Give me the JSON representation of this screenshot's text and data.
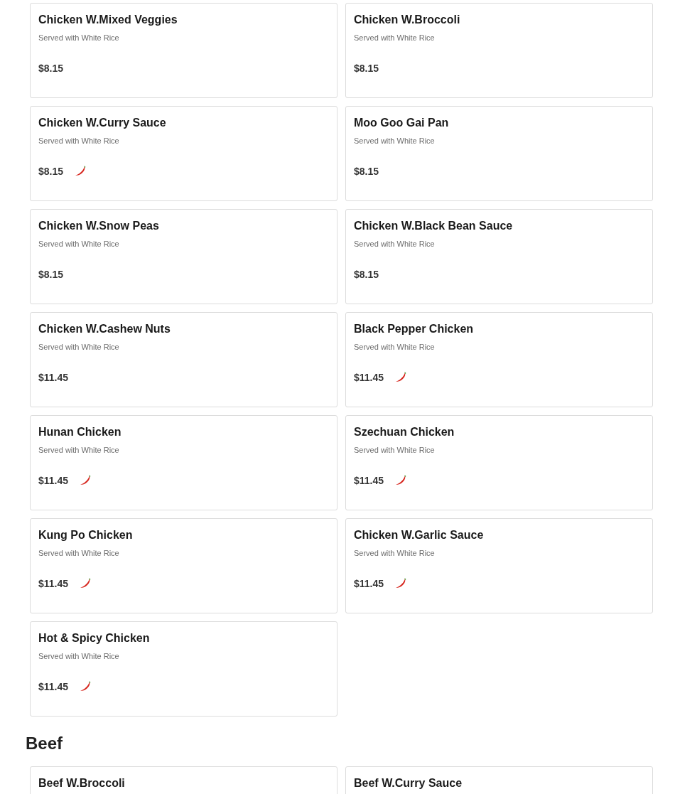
{
  "sections": [
    {
      "items": [
        {
          "name": "Chicken W.Mixed Veggies",
          "description": "Served with White Rice",
          "price": "$8.15",
          "spicy": false
        },
        {
          "name": "Chicken W.Broccoli",
          "description": "Served with White Rice",
          "price": "$8.15",
          "spicy": false
        },
        {
          "name": "Chicken W.Curry Sauce",
          "description": "Served with White Rice",
          "price": "$8.15",
          "spicy": true
        },
        {
          "name": "Moo Goo Gai Pan",
          "description": "Served with White Rice",
          "price": "$8.15",
          "spicy": false
        },
        {
          "name": "Chicken W.Snow Peas",
          "description": "Served with White Rice",
          "price": "$8.15",
          "spicy": false
        },
        {
          "name": "Chicken W.Black Bean Sauce",
          "description": "Served with White Rice",
          "price": "$8.15",
          "spicy": false
        },
        {
          "name": "Chicken W.Cashew Nuts",
          "description": "Served with White Rice",
          "price": "$11.45",
          "spicy": false
        },
        {
          "name": "Black Pepper Chicken",
          "description": "Served with White Rice",
          "price": "$11.45",
          "spicy": true
        },
        {
          "name": "Hunan Chicken",
          "description": "Served with White Rice",
          "price": "$11.45",
          "spicy": true
        },
        {
          "name": "Szechuan Chicken",
          "description": "Served with White Rice",
          "price": "$11.45",
          "spicy": true
        },
        {
          "name": "Kung Po Chicken",
          "description": "Served with White Rice",
          "price": "$11.45",
          "spicy": true
        },
        {
          "name": "Chicken W.Garlic Sauce",
          "description": "Served with White Rice",
          "price": "$11.45",
          "spicy": true
        },
        {
          "name": "Hot & Spicy Chicken",
          "description": "Served with White Rice",
          "price": "$11.45",
          "spicy": true
        }
      ]
    },
    {
      "title": "Beef",
      "items": [
        {
          "name": "Beef W.Broccoli"
        },
        {
          "name": "Beef W.Curry Sauce"
        }
      ]
    }
  ]
}
